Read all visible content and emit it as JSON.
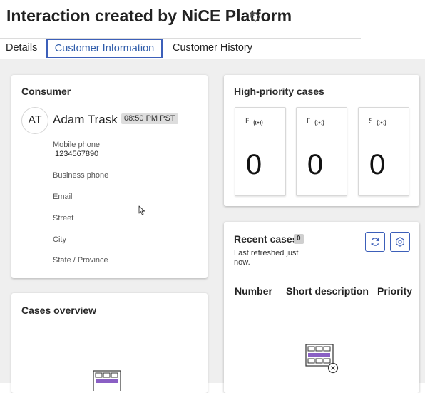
{
  "header": {
    "title": "Interaction created by NiCE Platform"
  },
  "tabs": [
    {
      "label": "Details",
      "active": false
    },
    {
      "label": "Customer Information",
      "active": true
    },
    {
      "label": "Customer History",
      "active": false
    }
  ],
  "consumer": {
    "title": "Consumer",
    "avatar_initials": "AT",
    "name": "Adam Trask",
    "local_time": "08:50 PM PST",
    "fields": [
      {
        "label": "Mobile phone",
        "value": "1234567890"
      },
      {
        "label": "Business phone",
        "value": ""
      },
      {
        "label": "Email",
        "value": ""
      },
      {
        "label": "Street",
        "value": ""
      },
      {
        "label": "City",
        "value": ""
      },
      {
        "label": "State / Province",
        "value": ""
      }
    ]
  },
  "high_priority": {
    "title": "High-priority cases",
    "boxes": [
      {
        "letter": "E",
        "count": "0"
      },
      {
        "letter": "F",
        "count": "0"
      },
      {
        "letter": "S",
        "count": "0"
      }
    ]
  },
  "recent_cases": {
    "title": "Recent cases",
    "count": "0",
    "refreshed": "Last refreshed just now.",
    "columns": [
      "Number",
      "Short description",
      "Priority"
    ]
  },
  "cases_overview": {
    "title": "Cases overview"
  },
  "colors": {
    "accent": "#3c5fb9",
    "panel_bg": "#efefef",
    "illustration_purple": "#8a5fc4"
  },
  "icons": [
    "tag-icon",
    "signal-icon",
    "refresh-icon",
    "settings-icon",
    "empty-table-icon",
    "mouse-cursor-icon"
  ]
}
